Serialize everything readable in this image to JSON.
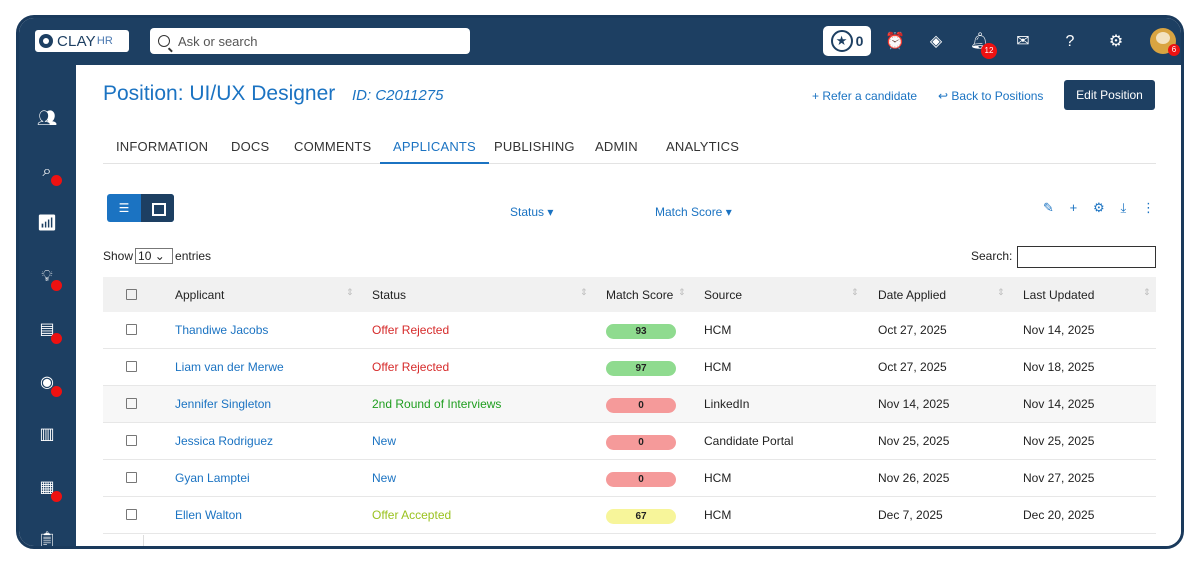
{
  "topbar": {
    "logo_main": "CLAY",
    "logo_sub": "HR",
    "search_placeholder": "Ask or search",
    "star_count": "0",
    "notifications_count": "12",
    "avatar_badge": "6"
  },
  "page": {
    "title": "Position: UI/UX Designer",
    "id": "ID: C2011275",
    "refer_label": "+ Refer a candidate",
    "back_label": "↩ Back to Positions",
    "edit_label": "Edit Position"
  },
  "tabs": [
    "INFORMATION",
    "DOCS",
    "COMMENTS",
    "APPLICANTS",
    "PUBLISHING",
    "ADMIN",
    "ANALYTICS"
  ],
  "active_tab": "APPLICANTS",
  "filters": {
    "status": "Status ▾",
    "match": "Match Score ▾"
  },
  "entries": {
    "show": "Show",
    "value": "10",
    "suffix": "entries",
    "search_label": "Search:"
  },
  "columns": [
    "Applicant",
    "Status",
    "Match Score",
    "Source",
    "Date Applied",
    "Last Updated"
  ],
  "rows": [
    {
      "name": "Thandiwe Jacobs",
      "status": "Offer Rejected",
      "status_color": "#d62b2b",
      "score": "93",
      "score_color": "#8fdb8f",
      "source": "HCM",
      "applied": "Oct 27, 2025",
      "updated": "Nov 14, 2025"
    },
    {
      "name": "Liam van der Merwe",
      "status": "Offer Rejected",
      "status_color": "#d62b2b",
      "score": "97",
      "score_color": "#8fdb8f",
      "source": "HCM",
      "applied": "Oct 27, 2025",
      "updated": "Nov 18, 2025"
    },
    {
      "name": "Jennifer Singleton",
      "status": "2nd Round of Interviews",
      "status_color": "#1f9e1f",
      "score": "0",
      "score_color": "#f59a9a",
      "source": "LinkedIn",
      "applied": "Nov 14, 2025",
      "updated": "Nov 14, 2025"
    },
    {
      "name": "Jessica Rodriguez",
      "status": "New",
      "status_color": "#1b73c2",
      "score": "0",
      "score_color": "#f59a9a",
      "source": "Candidate Portal",
      "applied": "Nov 25, 2025",
      "updated": "Nov 25, 2025"
    },
    {
      "name": "Gyan Lamptei",
      "status": "New",
      "status_color": "#1b73c2",
      "score": "0",
      "score_color": "#f59a9a",
      "source": "HCM",
      "applied": "Nov 26, 2025",
      "updated": "Nov 27, 2025"
    },
    {
      "name": "Ellen Walton",
      "status": "Offer Accepted",
      "status_color": "#9ac21f",
      "score": "67",
      "score_color": "#f7f59a",
      "source": "HCM",
      "applied": "Dec 7, 2025",
      "updated": "Dec 20, 2025"
    }
  ],
  "colors": {
    "navy": "#1d3f62",
    "accent": "#1b73c2"
  }
}
